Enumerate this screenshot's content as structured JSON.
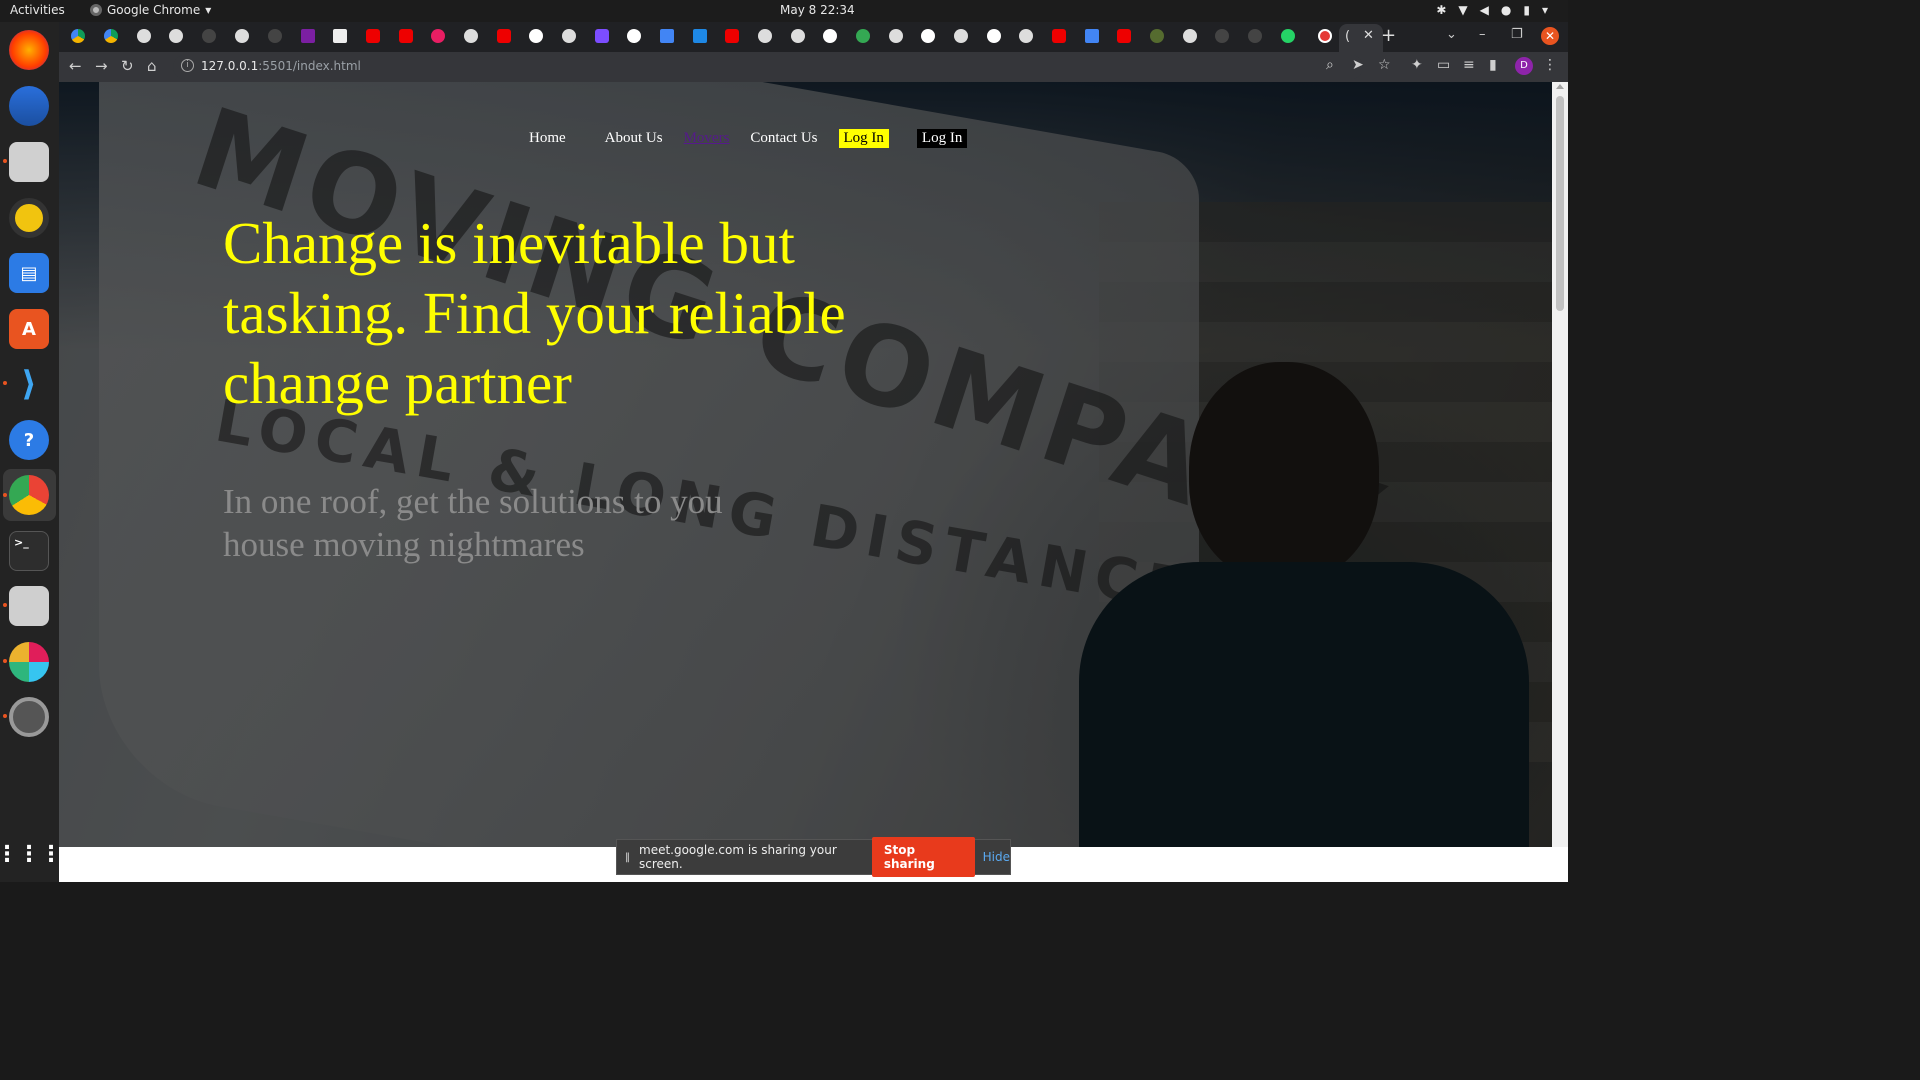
{
  "os_bar": {
    "activities": "Activities",
    "app_name": "Google Chrome",
    "clock": "May 8  22:34"
  },
  "browser": {
    "url_host": "127.0.0.1",
    "url_rest": ":5501/index.html",
    "profile_initial": "D"
  },
  "site": {
    "nav": {
      "home": "Home",
      "about": "About Us",
      "movers": "Movers",
      "contact": "Contact Us",
      "login_primary": "Log In",
      "login_secondary": "Log In"
    },
    "hero": {
      "headline": "Change is inevitable but tasking. Find your reliable change partner",
      "subhead": "In one roof, get the solutions to you house moving nightmares"
    },
    "background_image": {
      "van_text_line1": "MOVING COMPANY",
      "van_text_line2": "LOCAL & LONG DISTANCE"
    }
  },
  "share_bar": {
    "message": "meet.google.com is sharing your screen.",
    "stop_label": "Stop sharing",
    "hide_label": "Hide"
  },
  "colors": {
    "headline": "#ffff00",
    "subhead": "#8a8a8a",
    "login_primary_bg": "#ffff00",
    "login_secondary_bg": "#000000",
    "stop_button": "#e83a1c"
  }
}
